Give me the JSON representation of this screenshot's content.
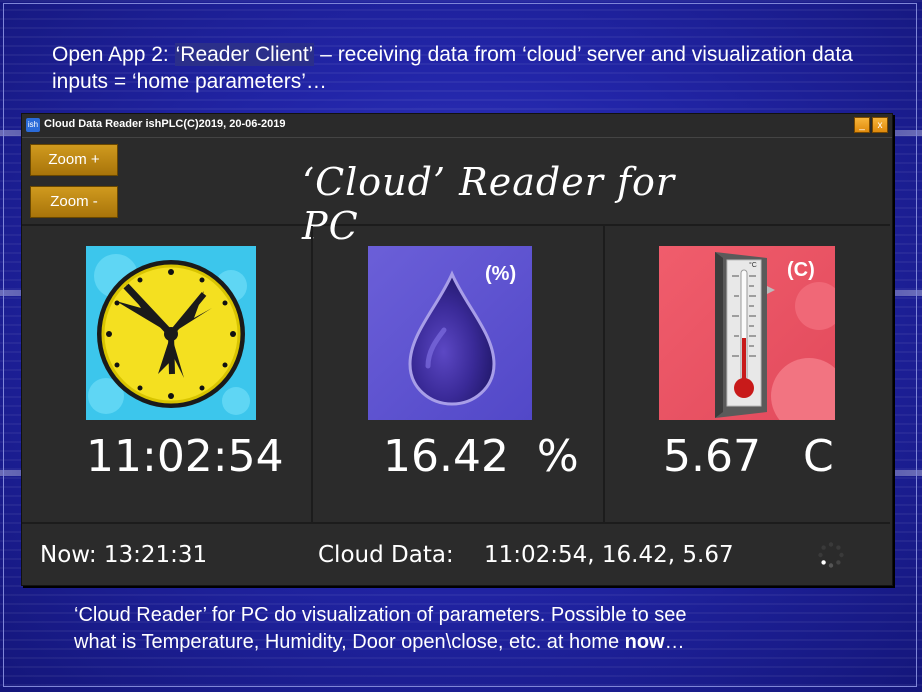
{
  "slide": {
    "heading_prefix": "Open App 2: ",
    "heading_highlight": "‘Reader Client’",
    "heading_rest": " – receiving data from ‘cloud’ server and visualization data inputs = ‘home parameters’…",
    "footer_line1": "‘Cloud Reader’ for PC do visualization of parameters. Possible to see",
    "footer_line2": "what is Temperature, Humidity, Door open\\close, etc. at home ",
    "footer_bold": "now",
    "footer_tail": "…"
  },
  "window": {
    "icon_text": "ish",
    "title": "Cloud Data Reader ishPLC(C)2019, 20-06-2019",
    "minimize_glyph": "_",
    "close_glyph": "x"
  },
  "toolbar": {
    "zoom_in_label": "Zoom +",
    "zoom_out_label": "Zoom -"
  },
  "brand": {
    "title": "‘Cloud’ Reader for PC"
  },
  "panels": {
    "time": {
      "value": "11:02:54",
      "icon": "clock-icon"
    },
    "humidity": {
      "value": "16.42  %",
      "badge": "(%)",
      "icon": "water-drop-icon"
    },
    "temperature": {
      "value": "5.67",
      "unit": "C",
      "badge": "(C)",
      "scale_label": "°C",
      "icon": "thermometer-icon"
    }
  },
  "status": {
    "now_text": "Now: 13:21:31",
    "cloud_label": "Cloud Data:",
    "cloud_values": "11:02:54, 16.42, 5.67"
  },
  "colors": {
    "zoom_button": "#c08a14",
    "titlebar_button": "#f0a020",
    "clock_background": "#3cc6ec",
    "clock_face": "#f4e020",
    "humidity_background": "#5a50d0",
    "temperature_background": "#e8505e"
  }
}
